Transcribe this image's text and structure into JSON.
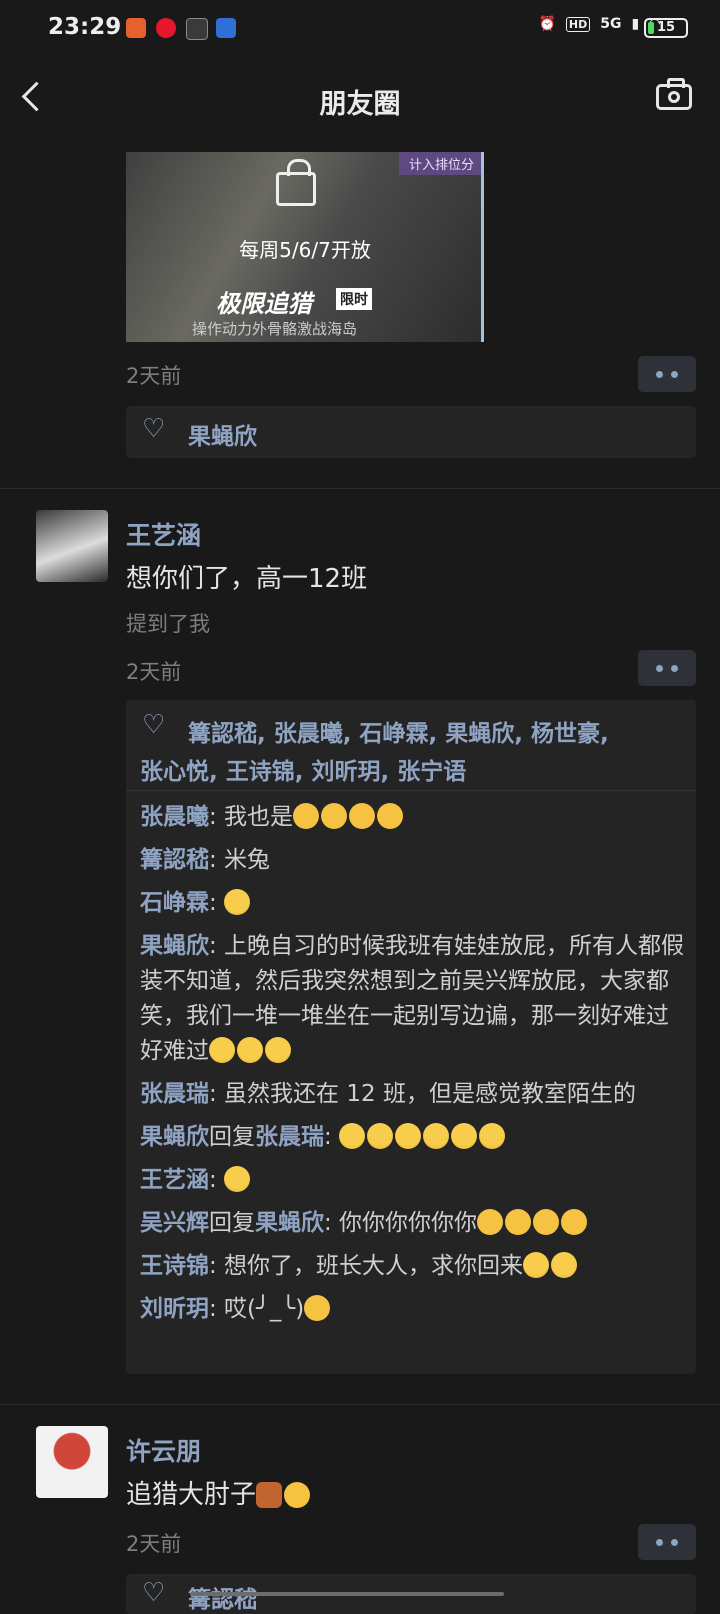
{
  "status_bar": {
    "time": "23:29",
    "battery": "15",
    "network": "5G",
    "hd": "HD"
  },
  "header": {
    "title": "朋友圈"
  },
  "post1": {
    "image": {
      "tag": "计入排位分",
      "line1": "每周5/6/7开放",
      "line2": "极限追猎",
      "badge": "限时",
      "line3": "操作动力外骨骼激战海岛"
    },
    "time": "2天前",
    "likes": "果蝇欣"
  },
  "post2": {
    "user": "王艺涵",
    "text": "想你们了，高一12班",
    "mention": "提到了我",
    "time": "2天前",
    "likes_line1": "篝認嵇, 张晨曦, 石峥霖, 果蝇欣, 杨世豪,",
    "likes_line2": "张心悦, 王诗锦, 刘昕玥, 张宁语",
    "comments": [
      {
        "name": "张晨曦",
        "text": ": 我也是"
      },
      {
        "name": "篝認嵇",
        "text": ": 米兔"
      },
      {
        "name": "石峥霖",
        "text": ": "
      },
      {
        "name": "果蝇欣",
        "text": ": 上晚自习的时候我班有娃娃放屁，所有人都假装不知道，然后我突然想到之前吴兴辉放屁，大家都笑，我们一堆一堆坐在一起别写边谝，那一刻好难过好难过"
      },
      {
        "name": "张晨瑞",
        "text": ": 虽然我还在 12 班，但是感觉教室陌生的"
      },
      {
        "name": "果蝇欣",
        "reply": "回复",
        "target": "张晨瑞",
        "text": ": "
      },
      {
        "name": "王艺涵",
        "text": ": "
      },
      {
        "name": "吴兴辉",
        "reply": "回复",
        "target": "果蝇欣",
        "text": ": 你你你你你你"
      },
      {
        "name": "王诗锦",
        "text": ": 想你了，班长大人，求你回来"
      },
      {
        "name": "刘昕玥",
        "text": ": 哎(╯_╰)"
      }
    ]
  },
  "post3": {
    "user": "许云朋",
    "text": "追猎大肘子",
    "time": "2天前",
    "likes": "篝認嵇"
  }
}
